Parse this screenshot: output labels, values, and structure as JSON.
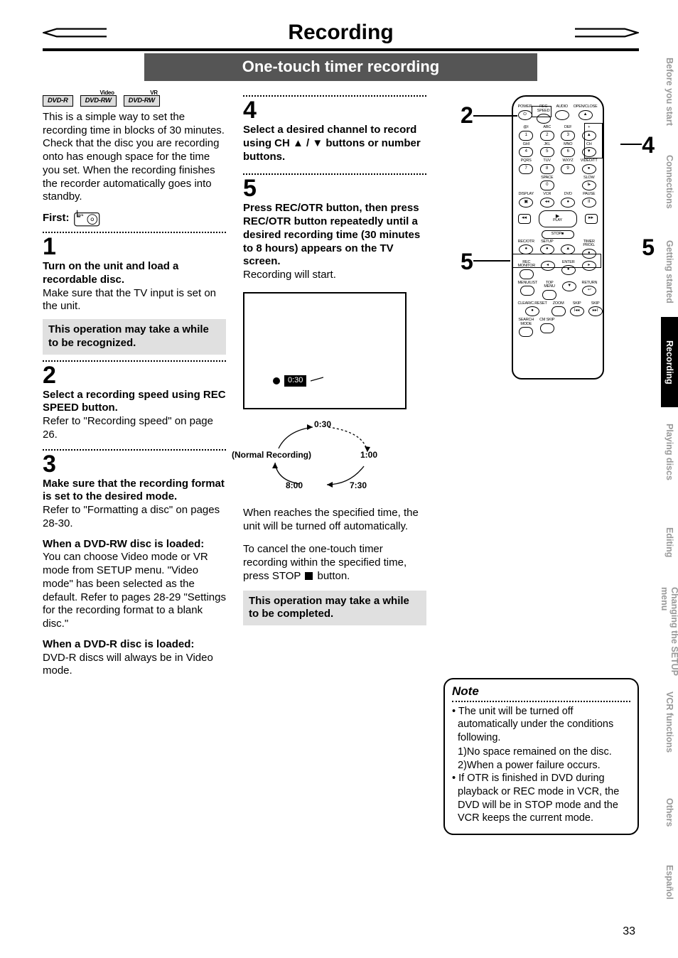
{
  "header": {
    "title": "Recording",
    "subtitle": "One-touch timer recording"
  },
  "disc_badges": {
    "a": "DVD-R",
    "b": "DVD-RW",
    "b_sup": "Video",
    "c": "DVD-RW",
    "c_sup": "VR"
  },
  "intro": "This is a simple way to set the recording time in blocks of 30 minutes. Check that the disc you are recording onto has enough space for the time you set. When the recording finishes the recorder automatically goes into standby.",
  "first_label": "First:",
  "steps": {
    "s1": {
      "num": "1",
      "bold": "Turn on the unit and load a recordable disc.",
      "body": "Make sure that the TV input is set on the unit.",
      "boxnote": "This operation may take a while to be recognized."
    },
    "s2": {
      "num": "2",
      "bold": "Select a recording speed using REC SPEED button.",
      "body": "Refer to \"Recording speed\" on page 26."
    },
    "s3": {
      "num": "3",
      "bold": "Make sure that the recording format is set to the desired mode.",
      "body": "Refer to \"Formatting a disc\" on pages 28-30.",
      "sub_a_title": "When a DVD-RW disc is loaded:",
      "sub_a_body": "You can choose Video mode or VR mode from SETUP menu. \"Video mode\" has been selected as the default. Refer to pages 28-29 \"Settings for the recording format to a blank disc.\"",
      "sub_b_title": "When a DVD-R disc is loaded:",
      "sub_b_body": "DVD-R discs will always be in Video mode."
    },
    "s4": {
      "num": "4",
      "bold": "Select a desired channel to record using CH ▲ / ▼ buttons or number buttons."
    },
    "s5": {
      "num": "5",
      "bold": "Press REC/OTR button, then press REC/OTR button repeatedly until a desired recording time (30 minutes to 8 hours) appears on the TV screen.",
      "body": "Recording will start."
    }
  },
  "osd": {
    "time": "0:30"
  },
  "cycle": {
    "t030": "0:30",
    "normal": "(Normal Recording)",
    "t100": "1:00",
    "t730": "7:30",
    "t800": "8:00"
  },
  "after": {
    "p1": "When reaches the specified time, the unit will be turned off automatically.",
    "p2_a": "To cancel the one-touch timer recording within the specified time, press STOP ",
    "p2_b": " button.",
    "boxnote": "This operation may take a while to be completed."
  },
  "remote_labels": {
    "row1": [
      "POWER",
      "REC SPEED",
      "AUDIO",
      "OPEN/CLOSE"
    ],
    "num_top": [
      "@/:",
      "ABC",
      "DEF"
    ],
    "nums1": [
      "1",
      "2",
      "3"
    ],
    "num_mid": [
      "GHI",
      "JKL",
      "MNO"
    ],
    "nums2": [
      "4",
      "5",
      "6"
    ],
    "num_bot": [
      "PQRS",
      "TUV",
      "WXYZ"
    ],
    "nums3": [
      "7",
      "8",
      "9"
    ],
    "rowx": [
      "",
      "SPACE",
      "",
      "SLOW"
    ],
    "nums0": [
      "",
      "0",
      "",
      ""
    ],
    "row_dvp": [
      "DISPLAY",
      "VCR",
      "DVD",
      "PAUSE"
    ],
    "play": "PLAY",
    "stop": "STOP",
    "row_rec": [
      "REC/OTR",
      "SETUP",
      "",
      "TIMER PROG."
    ],
    "row_mon": [
      "REC MONITOR",
      "",
      "ENTER",
      ""
    ],
    "row_menu": [
      "MENU/LIST",
      "TOP MENU",
      "",
      "RETURN"
    ],
    "row_skip": [
      "CLEAR/C.RESET",
      "ZOOM",
      "SKIP",
      "SKIP"
    ],
    "row_last": [
      "SEARCH MODE",
      "CM SKIP"
    ],
    "ch": "CH",
    "videott": "VIDEO/TT"
  },
  "callouts": {
    "c2": "2",
    "c4": "4",
    "c5a": "5",
    "c5b": "5"
  },
  "note": {
    "title": "Note",
    "b1": "The unit will be turned off automatically under the conditions following.",
    "b1_1": "1)No space remained on the disc.",
    "b1_2": "2)When a power failure occurs.",
    "b2": "If OTR is finished in DVD during playback or REC mode in VCR, the DVD will be in STOP mode and the VCR keeps the current mode."
  },
  "side_tabs": [
    "Before you start",
    "Connections",
    "Getting started",
    "Recording",
    "Playing discs",
    "Editing",
    "Changing the SETUP menu",
    "VCR functions",
    "Others",
    "Español"
  ],
  "page_number": "33"
}
